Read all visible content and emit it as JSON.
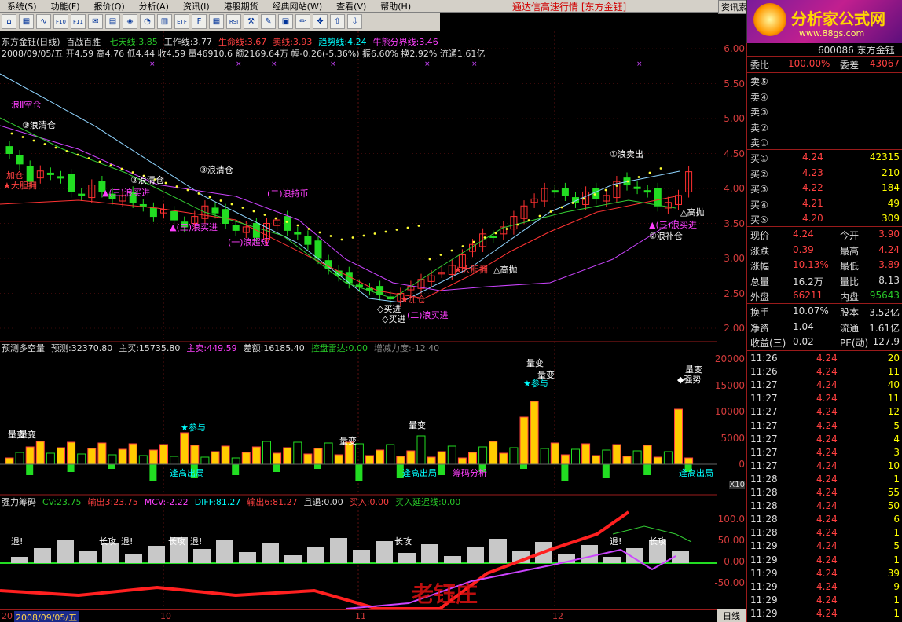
{
  "menu": {
    "items": [
      "系统(S)",
      "功能(F)",
      "报价(Q)",
      "分析(A)",
      "资讯(I)",
      "港股期货",
      "经典网站(W)",
      "查看(V)",
      "帮助(H)"
    ],
    "center_title": "通达信高速行情 [东方金钰]",
    "right_button": "资讯素"
  },
  "toolbar": {
    "icons": [
      "home-icon",
      "grid-icon",
      "line-chart-icon",
      "f10-icon",
      "f11-icon",
      "envelope-icon",
      "doc-icon",
      "settings-icon",
      "pie-icon",
      "bars-icon",
      "etf-icon",
      "f-icon",
      "bars2-icon",
      "rsi-icon",
      "tools-icon",
      "wrench-icon",
      "box-icon",
      "pencil-icon",
      "crosshair-icon",
      "up-arrow-icon",
      "down-arrow-icon"
    ],
    "labels": [
      "⌂",
      "▦",
      "∿",
      "F10",
      "F11",
      "✉",
      "▤",
      "◈",
      "◔",
      "▥",
      "ETF",
      "F",
      "▦",
      "RSI",
      "⚒",
      "✎",
      "▣",
      "✏",
      "✥",
      "⇧",
      "⇩"
    ]
  },
  "logo": {
    "name": "分析家公式网",
    "url": "www.88gs.com"
  },
  "chart": {
    "line1": {
      "code": "东方金钰(日线)",
      "mode": "百战百胜",
      "items": [
        {
          "text": "七天线:3.85",
          "color": "#28c828"
        },
        {
          "text": "工作线:3.77",
          "color": "#dcdcdc"
        },
        {
          "text": "生命线:3.67",
          "color": "#ff4040"
        },
        {
          "text": "卖线:3.93",
          "color": "#ff4040"
        },
        {
          "text": "趋势线:4.24",
          "color": "#00ffff"
        },
        {
          "text": "牛熊分界线:3.46",
          "color": "#ff40ff"
        }
      ]
    },
    "line2": "2008/09/05/五 开4.59 高4.76 低4.44 收4.59 量46910.6 额2169.64万 幅-0.26(-5.36%) 振6.60% 换2.92% 流通1.61亿",
    "price_ticks": [
      "6.00",
      "5.50",
      "5.00",
      "4.50",
      "4.00",
      "3.50",
      "3.00",
      "2.50",
      "2.00"
    ],
    "labels": [
      {
        "text": "浪Ⅱ空仓",
        "color": "#ff40ff"
      },
      {
        "text": "③浪清仓",
        "color": "#ffffff"
      },
      {
        "text": "加仓",
        "color": "#ff4040"
      },
      {
        "text": "★大胆拥",
        "color": "#ff4040"
      },
      {
        "text": "▲(三)浪买进",
        "color": "#ff40ff"
      },
      {
        "text": "▲(三)浪买进",
        "color": "#ff40ff"
      },
      {
        "text": "③浪清仓",
        "color": "#ffffff"
      },
      {
        "text": "③浪清仓",
        "color": "#ffffff"
      },
      {
        "text": "(二)浪持币",
        "color": "#ff40ff"
      },
      {
        "text": "(一)浪超短",
        "color": "#ff40ff"
      },
      {
        "text": "①浪卖出",
        "color": "#ffffff"
      },
      {
        "text": "★大胆拥",
        "color": "#ff4040"
      },
      {
        "text": "△高抛",
        "color": "#ffffff"
      },
      {
        "text": "△高抛",
        "color": "#ffffff"
      },
      {
        "text": "▲(三)浪买进",
        "color": "#ff40ff"
      },
      {
        "text": "②浪补仓",
        "color": "#ffffff"
      },
      {
        "text": "★加仓",
        "color": "#ff4040"
      },
      {
        "text": "◇买进",
        "color": "#ffffff"
      },
      {
        "text": "(二)浪买进",
        "color": "#ff40ff"
      },
      {
        "text": "◇买进",
        "color": "#ffffff"
      }
    ]
  },
  "vol_panel": {
    "title_items": [
      {
        "text": "预测多空量",
        "color": "#dcdcdc"
      },
      {
        "text": "预测:32370.80",
        "color": "#dcdcdc"
      },
      {
        "text": "主买:15735.80",
        "color": "#dcdcdc"
      },
      {
        "text": "主卖:449.59",
        "color": "#ff40ff"
      },
      {
        "text": "差额:16185.40",
        "color": "#dcdcdc"
      },
      {
        "text": "控盘雷达:0.00",
        "color": "#28c828"
      },
      {
        "text": "增减力度:-12.40",
        "color": "#888888"
      }
    ],
    "ticks": [
      "20000",
      "15000",
      "10000",
      "5000",
      "0"
    ],
    "scale_label": "X10",
    "labels": [
      {
        "text": "量变",
        "color": "#ffffff"
      },
      {
        "text": "量变",
        "color": "#ffffff"
      },
      {
        "text": "★参与",
        "color": "#00ffff"
      },
      {
        "text": "逢高出局",
        "color": "#00ffff"
      },
      {
        "text": "量变",
        "color": "#ffffff"
      },
      {
        "text": "量变",
        "color": "#ffffff"
      },
      {
        "text": "逢高出局",
        "color": "#00ffff"
      },
      {
        "text": "筹码分析",
        "color": "#ff40ff"
      },
      {
        "text": "量变",
        "color": "#ffffff"
      },
      {
        "text": "量变",
        "color": "#ffffff"
      },
      {
        "text": "★参与",
        "color": "#00ffff"
      },
      {
        "text": "逢高出局",
        "color": "#00ffff"
      },
      {
        "text": "量变",
        "color": "#ffffff"
      },
      {
        "text": "◆强势",
        "color": "#ffffff"
      }
    ]
  },
  "chip_panel": {
    "title_items": [
      {
        "text": "强力筹码",
        "color": "#dcdcdc"
      },
      {
        "text": "CV:23.75",
        "color": "#28c828"
      },
      {
        "text": "输出3:23.75",
        "color": "#ff4040"
      },
      {
        "text": "MCV:-2.22",
        "color": "#ff40ff"
      },
      {
        "text": "DIFF:81.27",
        "color": "#00ffff"
      },
      {
        "text": "输出6:81.27",
        "color": "#ff4040"
      },
      {
        "text": "且退:0.00",
        "color": "#dcdcdc"
      },
      {
        "text": "买入:0.00",
        "color": "#ff4040"
      },
      {
        "text": "买入延迟线:0.00",
        "color": "#28c828"
      }
    ],
    "ticks": [
      "100.0",
      "50.00",
      "0.00",
      "-50.00"
    ],
    "labels": [
      "退!",
      "长攻",
      "退!",
      "长攻",
      "退!",
      "长攻",
      "退!",
      "长攻"
    ],
    "watermark": "老钰庄"
  },
  "dates": [
    "20",
    "2008/09/05/五",
    "10",
    "11",
    "12"
  ],
  "axis_footer": "日线",
  "panel": {
    "stock_title": "600086 东方金钰",
    "weibi": {
      "label": "委比",
      "value": "100.00%",
      "label2": "委差",
      "value2": "43067"
    },
    "sells": [
      {
        "label": "卖⑤",
        "price": "",
        "vol": ""
      },
      {
        "label": "卖④",
        "price": "",
        "vol": ""
      },
      {
        "label": "卖③",
        "price": "",
        "vol": ""
      },
      {
        "label": "卖②",
        "price": "",
        "vol": ""
      },
      {
        "label": "卖①",
        "price": "",
        "vol": ""
      }
    ],
    "buys": [
      {
        "label": "买①",
        "price": "4.24",
        "vol": "42315"
      },
      {
        "label": "买②",
        "price": "4.23",
        "vol": "210"
      },
      {
        "label": "买③",
        "price": "4.22",
        "vol": "184"
      },
      {
        "label": "买④",
        "price": "4.21",
        "vol": "49"
      },
      {
        "label": "买⑤",
        "price": "4.20",
        "vol": "309"
      }
    ],
    "stats": [
      {
        "l1": "现价",
        "v1": "4.24",
        "c1": "red",
        "l2": "今开",
        "v2": "3.90",
        "c2": "red"
      },
      {
        "l1": "涨跌",
        "v1": "0.39",
        "c1": "red",
        "l2": "最高",
        "v2": "4.24",
        "c2": "red"
      },
      {
        "l1": "涨幅",
        "v1": "10.13%",
        "c1": "red",
        "l2": "最低",
        "v2": "3.89",
        "c2": "red"
      },
      {
        "l1": "总量",
        "v1": "16.2万",
        "c1": "wht",
        "l2": "量比",
        "v2": "8.13",
        "c2": "wht"
      },
      {
        "l1": "外盘",
        "v1": "66211",
        "c1": "red",
        "l2": "内盘",
        "v2": "95643",
        "c2": "grn"
      }
    ],
    "stats2": [
      {
        "l1": "换手",
        "v1": "10.07%",
        "l2": "股本",
        "v2": "3.52亿"
      },
      {
        "l1": "净资",
        "v1": "1.04",
        "l2": "流通",
        "v2": "1.61亿"
      },
      {
        "l1": "收益(三)",
        "v1": "0.02",
        "l2": "PE(动)",
        "v2": "127.9"
      }
    ],
    "ticks": [
      {
        "t": "11:26",
        "p": "4.24",
        "v": "20"
      },
      {
        "t": "11:26",
        "p": "4.24",
        "v": "11"
      },
      {
        "t": "11:27",
        "p": "4.24",
        "v": "40"
      },
      {
        "t": "11:27",
        "p": "4.24",
        "v": "11"
      },
      {
        "t": "11:27",
        "p": "4.24",
        "v": "12"
      },
      {
        "t": "11:27",
        "p": "4.24",
        "v": "5"
      },
      {
        "t": "11:27",
        "p": "4.24",
        "v": "4"
      },
      {
        "t": "11:27",
        "p": "4.24",
        "v": "3"
      },
      {
        "t": "11:27",
        "p": "4.24",
        "v": "10"
      },
      {
        "t": "11:28",
        "p": "4.24",
        "v": "1"
      },
      {
        "t": "11:28",
        "p": "4.24",
        "v": "55"
      },
      {
        "t": "11:28",
        "p": "4.24",
        "v": "50"
      },
      {
        "t": "11:28",
        "p": "4.24",
        "v": "6"
      },
      {
        "t": "11:28",
        "p": "4.24",
        "v": "1"
      },
      {
        "t": "11:29",
        "p": "4.24",
        "v": "5"
      },
      {
        "t": "11:29",
        "p": "4.24",
        "v": "1"
      },
      {
        "t": "11:29",
        "p": "4.24",
        "v": "39"
      },
      {
        "t": "11:29",
        "p": "4.24",
        "v": "9"
      },
      {
        "t": "11:29",
        "p": "4.24",
        "v": "1"
      },
      {
        "t": "11:29",
        "p": "4.24",
        "v": "1"
      }
    ]
  }
}
